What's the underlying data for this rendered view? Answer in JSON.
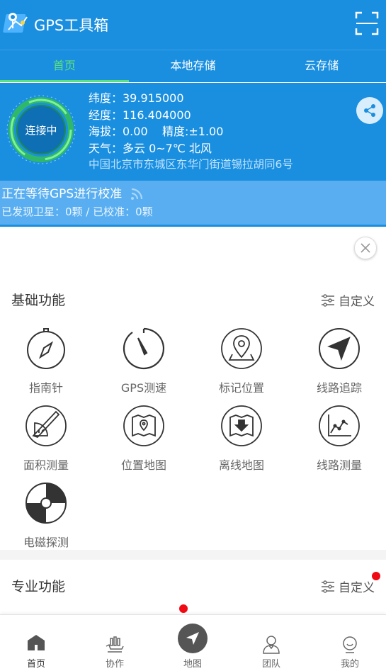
{
  "header": {
    "title": "GPS工具箱"
  },
  "tabs": [
    {
      "label": "首页",
      "active": true
    },
    {
      "label": "本地存储",
      "active": false
    },
    {
      "label": "云存储",
      "active": false
    }
  ],
  "gps": {
    "ring_label": "连接中",
    "latitude": "纬度：39.915000",
    "longitude": "经度：116.404000",
    "altitude_accuracy": "海拔：0.00    精度:±1.00",
    "weather": "天气：多云 0~7℃ 北风",
    "address": "中国北京市东城区东华门街道锡拉胡同6号"
  },
  "status": {
    "title": "正在等待GPS进行校准",
    "satellites": "已发现卫星：0颗 / 已校准：0颗"
  },
  "basic": {
    "title": "基础功能",
    "custom_label": "自定义",
    "items": [
      {
        "label": "指南针",
        "icon": "compass-icon"
      },
      {
        "label": "GPS测速",
        "icon": "speedometer-icon"
      },
      {
        "label": "标记位置",
        "icon": "location-pin-icon"
      },
      {
        "label": "线路追踪",
        "icon": "navigation-arrow-icon"
      },
      {
        "label": "面积测量",
        "icon": "protractor-icon"
      },
      {
        "label": "位置地图",
        "icon": "map-pin-icon"
      },
      {
        "label": "离线地图",
        "icon": "offline-map-icon"
      },
      {
        "label": "线路测量",
        "icon": "line-chart-icon"
      },
      {
        "label": "电磁探测",
        "icon": "disc-icon"
      }
    ]
  },
  "pro": {
    "title": "专业功能",
    "custom_label": "自定义"
  },
  "bottom_nav": [
    {
      "label": "首页",
      "icon": "home-icon"
    },
    {
      "label": "协作",
      "icon": "collaborate-icon"
    },
    {
      "label": "地图",
      "icon": "map-navigation-icon"
    },
    {
      "label": "团队",
      "icon": "team-icon"
    },
    {
      "label": "我的",
      "icon": "profile-icon"
    }
  ],
  "colors": {
    "primary": "#1a8fe0",
    "accent_green": "#5ee07c",
    "badge_red": "#f00a14"
  }
}
